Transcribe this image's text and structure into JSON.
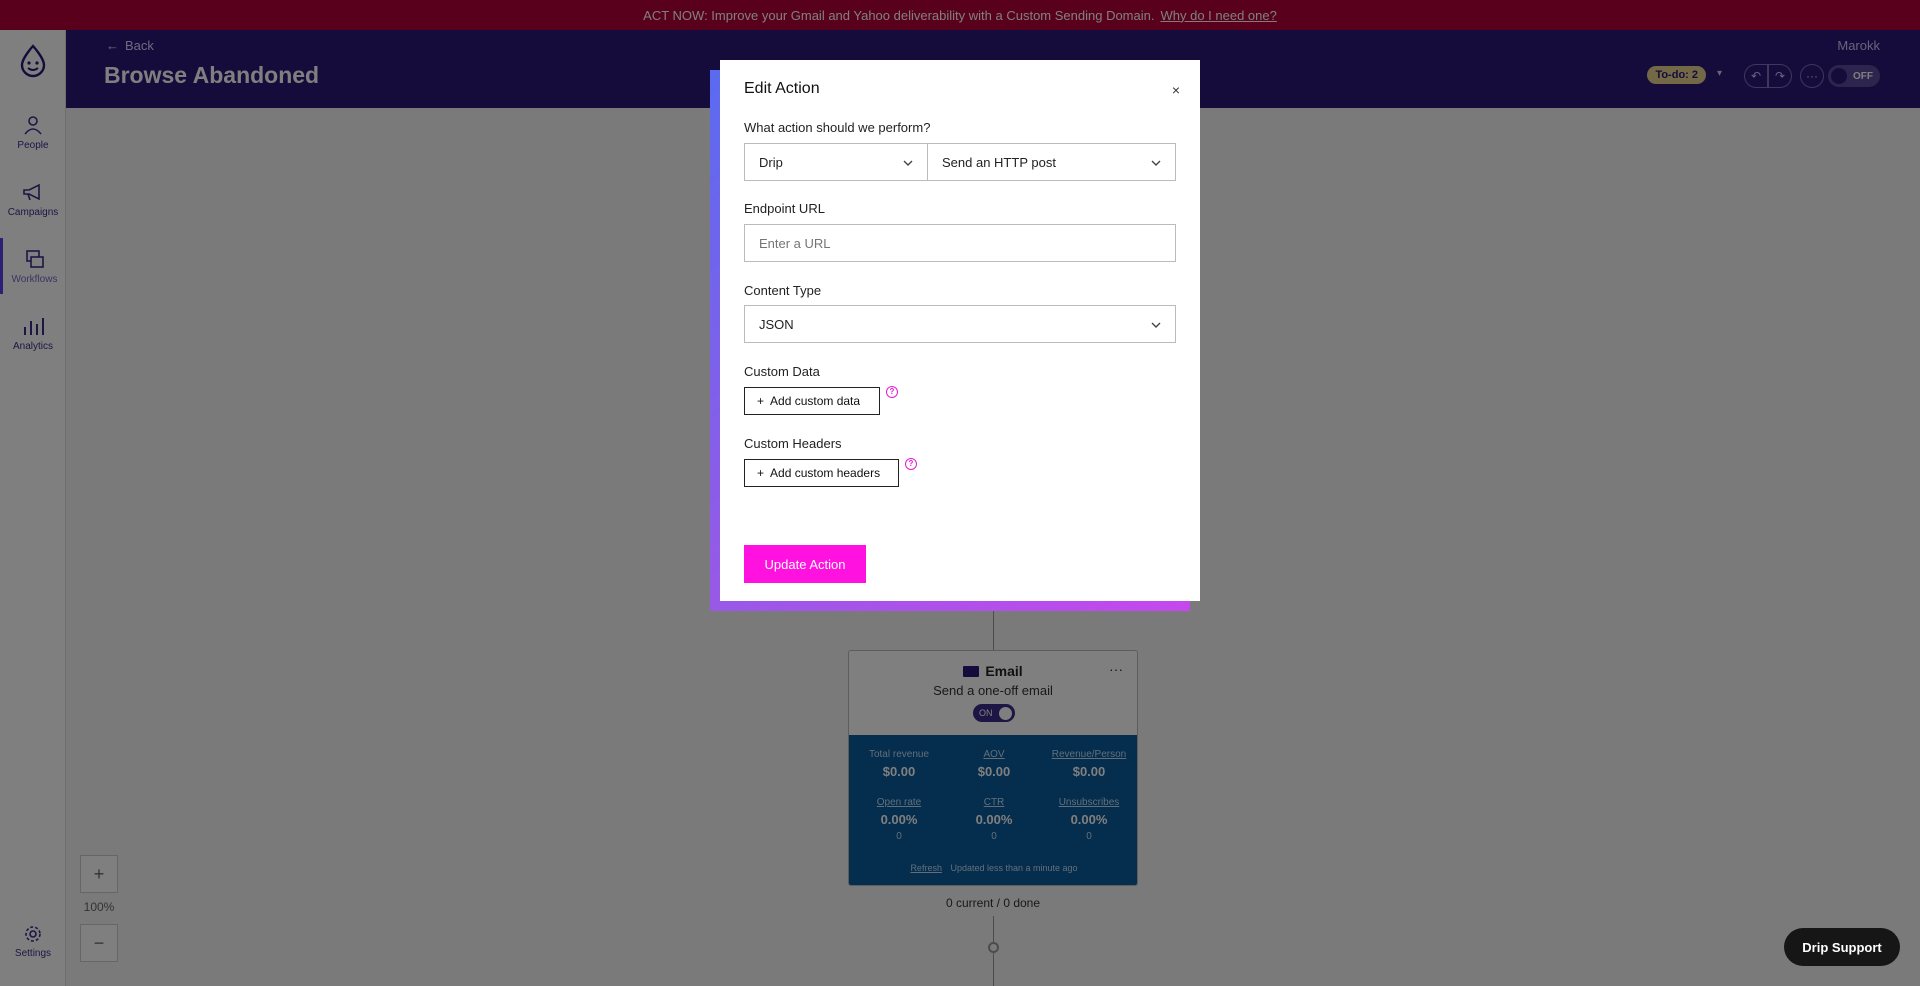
{
  "banner": {
    "message": "ACT NOW: Improve your Gmail and Yahoo deliverability with a Custom Sending Domain.",
    "link": "Why do I need one?"
  },
  "nav": {
    "items": [
      {
        "label": "People",
        "icon": "people-icon"
      },
      {
        "label": "Campaigns",
        "icon": "megaphone-icon"
      },
      {
        "label": "Workflows",
        "icon": "workflow-icon"
      },
      {
        "label": "Analytics",
        "icon": "chart-icon"
      }
    ],
    "settings": "Settings"
  },
  "header": {
    "back": "Back",
    "title": "Browse Abandoned",
    "account": "Marokk",
    "todo": "To-do: 2",
    "toggle": "OFF"
  },
  "email_card": {
    "title": "Email",
    "subtitle": "Send a one-off email",
    "toggle": "ON",
    "stats": [
      {
        "label": "Total revenue",
        "value": "$0.00",
        "count": ""
      },
      {
        "label": "AOV",
        "value": "$0.00",
        "count": ""
      },
      {
        "label": "Revenue/Person",
        "value": "$0.00",
        "count": ""
      },
      {
        "label": "Open rate",
        "value": "0.00%",
        "count": "0"
      },
      {
        "label": "CTR",
        "value": "0.00%",
        "count": "0"
      },
      {
        "label": "Unsubscribes",
        "value": "0.00%",
        "count": "0"
      }
    ],
    "refresh": "Refresh",
    "updated": "Updated less than a minute ago",
    "progress": "0 current / 0 done"
  },
  "zoom": {
    "plus": "+",
    "level": "100%",
    "minus": "−"
  },
  "modal": {
    "title": "Edit Action",
    "close": "×",
    "action_label": "What action should we perform?",
    "provider": "Drip",
    "action": "Send an HTTP post",
    "endpoint_label": "Endpoint URL",
    "endpoint_placeholder": "Enter a URL",
    "content_type_label": "Content Type",
    "content_type": "JSON",
    "custom_data_label": "Custom Data",
    "add_custom_data": "Add custom data",
    "custom_headers_label": "Custom Headers",
    "add_custom_headers": "Add custom headers",
    "update": "Update Action"
  },
  "support": "Drip Support"
}
